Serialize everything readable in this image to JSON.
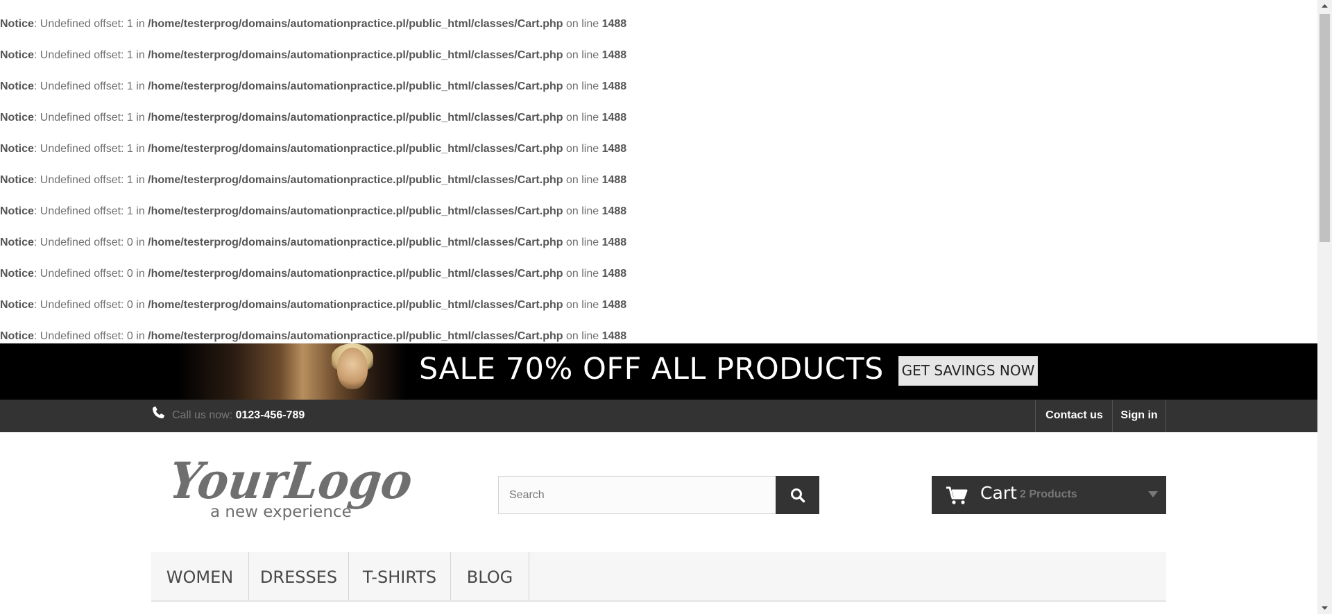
{
  "notices": [
    {
      "label": "Notice",
      "message": ": Undefined offset: 1 in ",
      "file": "/home/testerprog/domains/automationpractice.pl/public_html/classes/Cart.php",
      "mid": " on line ",
      "line": "1488"
    },
    {
      "label": "Notice",
      "message": ": Undefined offset: 1 in ",
      "file": "/home/testerprog/domains/automationpractice.pl/public_html/classes/Cart.php",
      "mid": " on line ",
      "line": "1488"
    },
    {
      "label": "Notice",
      "message": ": Undefined offset: 1 in ",
      "file": "/home/testerprog/domains/automationpractice.pl/public_html/classes/Cart.php",
      "mid": " on line ",
      "line": "1488"
    },
    {
      "label": "Notice",
      "message": ": Undefined offset: 1 in ",
      "file": "/home/testerprog/domains/automationpractice.pl/public_html/classes/Cart.php",
      "mid": " on line ",
      "line": "1488"
    },
    {
      "label": "Notice",
      "message": ": Undefined offset: 1 in ",
      "file": "/home/testerprog/domains/automationpractice.pl/public_html/classes/Cart.php",
      "mid": " on line ",
      "line": "1488"
    },
    {
      "label": "Notice",
      "message": ": Undefined offset: 1 in ",
      "file": "/home/testerprog/domains/automationpractice.pl/public_html/classes/Cart.php",
      "mid": " on line ",
      "line": "1488"
    },
    {
      "label": "Notice",
      "message": ": Undefined offset: 1 in ",
      "file": "/home/testerprog/domains/automationpractice.pl/public_html/classes/Cart.php",
      "mid": " on line ",
      "line": "1488"
    },
    {
      "label": "Notice",
      "message": ": Undefined offset: 0 in ",
      "file": "/home/testerprog/domains/automationpractice.pl/public_html/classes/Cart.php",
      "mid": " on line ",
      "line": "1488"
    },
    {
      "label": "Notice",
      "message": ": Undefined offset: 0 in ",
      "file": "/home/testerprog/domains/automationpractice.pl/public_html/classes/Cart.php",
      "mid": " on line ",
      "line": "1488"
    },
    {
      "label": "Notice",
      "message": ": Undefined offset: 0 in ",
      "file": "/home/testerprog/domains/automationpractice.pl/public_html/classes/Cart.php",
      "mid": " on line ",
      "line": "1488"
    },
    {
      "label": "Notice",
      "message": ": Undefined offset: 0 in ",
      "file": "/home/testerprog/domains/automationpractice.pl/public_html/classes/Cart.php",
      "mid": " on line ",
      "line": "1488"
    }
  ],
  "banner": {
    "headline": "SALE 70% OFF ALL PRODUCTS",
    "button_label": "GET SAVINGS NOW"
  },
  "topbar": {
    "call_prefix": "Call us now: ",
    "phone": "0123-456-789",
    "contact_label": "Contact us",
    "signin_label": "Sign in",
    "phone_icon": "phone-icon"
  },
  "logo": {
    "main": "YourLogo",
    "tagline": "a new experience"
  },
  "search": {
    "placeholder": "Search",
    "icon": "search-icon"
  },
  "cart": {
    "label": "Cart",
    "count_text": "2 Products",
    "icon": "cart-icon"
  },
  "menu": {
    "items": [
      "WOMEN",
      "DRESSES",
      "T-SHIRTS",
      "BLOG"
    ]
  },
  "colors": {
    "dark": "#333333",
    "banner_bg": "#000000",
    "menu_bg": "#f6f6f6"
  }
}
